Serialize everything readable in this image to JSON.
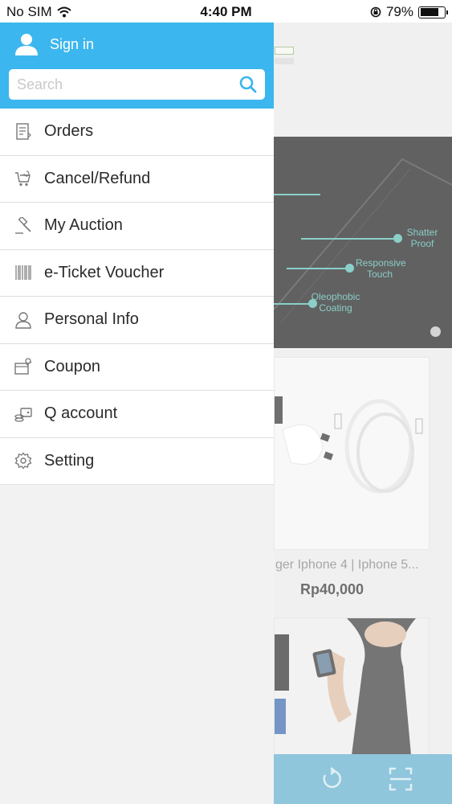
{
  "status_bar": {
    "carrier": "No SIM",
    "time": "4:40 PM",
    "battery": "79%",
    "battery_level": 0.79
  },
  "drawer": {
    "sign_in_label": "Sign in",
    "search_placeholder": "Search",
    "menu_items": [
      {
        "label": "Orders",
        "icon": "orders-icon"
      },
      {
        "label": "Cancel/Refund",
        "icon": "cart-return-icon"
      },
      {
        "label": "My Auction",
        "icon": "gavel-icon"
      },
      {
        "label": "e-Ticket Voucher",
        "icon": "barcode-icon"
      },
      {
        "label": "Personal Info",
        "icon": "person-icon"
      },
      {
        "label": "Coupon",
        "icon": "coupon-icon"
      },
      {
        "label": "Q account",
        "icon": "wallet-icon"
      },
      {
        "label": "Setting",
        "icon": "gear-icon"
      }
    ]
  },
  "background": {
    "banner_features": [
      "Shatter Proof",
      "Responsive Touch",
      "Oleophobic Coating"
    ],
    "product": {
      "title": "ger Iphone 4 | Iphone 5...",
      "price": "Rp40,000"
    }
  },
  "colors": {
    "header_blue": "#3cb6ee",
    "bottom_bar": "#53a8c9",
    "banner_accent": "#4db6ac"
  }
}
